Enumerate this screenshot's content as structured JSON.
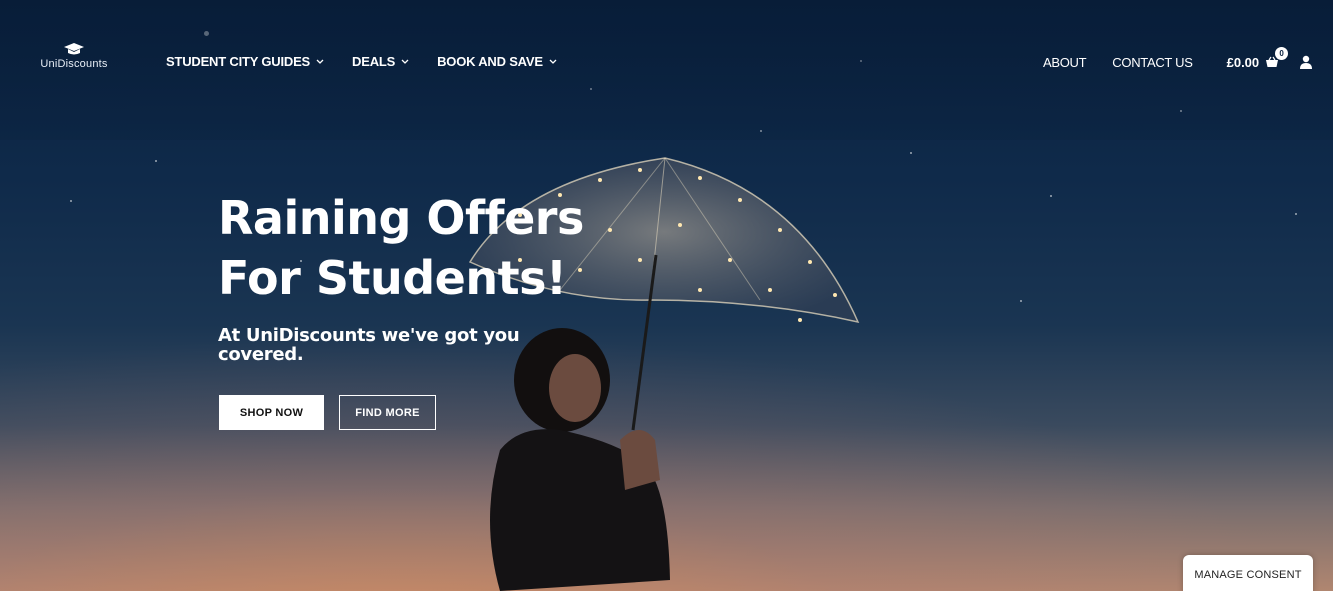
{
  "brand": {
    "name": "UniDiscounts",
    "icon": "graduation-cap-icon"
  },
  "nav": {
    "left": [
      {
        "label": "STUDENT CITY GUIDES",
        "icon": "chevron-down-icon"
      },
      {
        "label": "DEALS",
        "icon": "chevron-down-icon"
      },
      {
        "label": "BOOK AND SAVE",
        "icon": "chevron-down-icon"
      }
    ],
    "right": {
      "about": "ABOUT",
      "contact": "CONTACT US"
    }
  },
  "cart": {
    "total": "£0.00",
    "count": "0",
    "icon": "basket-icon"
  },
  "account": {
    "icon": "user-icon"
  },
  "hero": {
    "title_line1": "Raining Offers",
    "title_line2": "For Students!",
    "subtitle": "At UniDiscounts we've got you covered.",
    "primary_button": "SHOP NOW",
    "secondary_button": "FIND MORE"
  },
  "consent": {
    "label": "MANAGE CONSENT"
  },
  "colors": {
    "sky_top": "#0b2240",
    "sky_horizon": "#b08670",
    "button_primary_bg": "#ffffff"
  }
}
